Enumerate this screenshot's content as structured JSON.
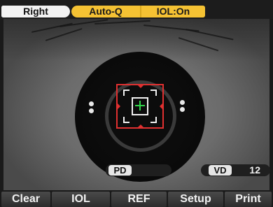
{
  "status_bar": {
    "eye": "Right",
    "mode": "Auto-Q",
    "iol": "IOL:On"
  },
  "readouts": {
    "pd_label": "PD",
    "pd_value": "",
    "vd_label": "VD",
    "vd_value": "12"
  },
  "menu": {
    "clear": "Clear",
    "iol": "IOL",
    "ref": "REF",
    "setup": "Setup",
    "print": "Print"
  },
  "colors": {
    "accent_yellow": "#f5c233",
    "target_red": "#e03030",
    "crosshair_green": "#2fd64a"
  },
  "icons": [
    "alignment-target-icon",
    "crosshair-icon"
  ]
}
